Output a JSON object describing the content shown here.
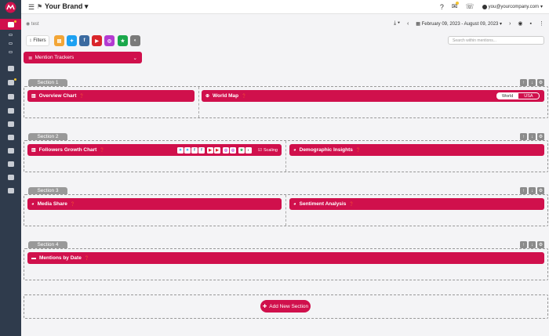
{
  "topbar": {
    "brand": "Your Brand",
    "user_email": "you@yourcompany.com",
    "help_label": "?"
  },
  "breadcrumb": "test",
  "toolbar": {
    "date_range": "February 09, 2023 - August 09, 2023"
  },
  "filters": {
    "label": "Filters"
  },
  "sources": [
    {
      "name": "news-icon",
      "color": "#f2a536"
    },
    {
      "name": "twitter-icon",
      "color": "#1da1f2"
    },
    {
      "name": "facebook-icon",
      "color": "#3b6aa0"
    },
    {
      "name": "youtube-icon",
      "color": "#d9252a"
    },
    {
      "name": "instagram-icon",
      "color": "#b43ad1"
    },
    {
      "name": "star-icon",
      "color": "#1aa84b"
    },
    {
      "name": "contrast-icon",
      "color": "#7a7a7a"
    }
  ],
  "search": {
    "placeholder": "Search within mentions..."
  },
  "tracker": {
    "label": "Mention Trackers"
  },
  "sections": [
    {
      "title": "Section 1",
      "widgets": [
        "Overview Chart",
        "World Map"
      ]
    },
    {
      "title": "Section 2",
      "widgets": [
        "Followers Growth Chart",
        "Demographic Insights"
      ]
    },
    {
      "title": "Section 3",
      "widgets": [
        "Media Share",
        "Sentiment Analysis"
      ]
    },
    {
      "title": "Section 4",
      "widgets": [
        "Mentions by Date"
      ]
    }
  ],
  "worldmap_toggle": {
    "world": "World",
    "usa": "USA"
  },
  "scaling_label": "Scaling",
  "add_section": "Add New Section",
  "colors": {
    "accent": "#d0104c",
    "sidebar": "#2f3b4c"
  }
}
